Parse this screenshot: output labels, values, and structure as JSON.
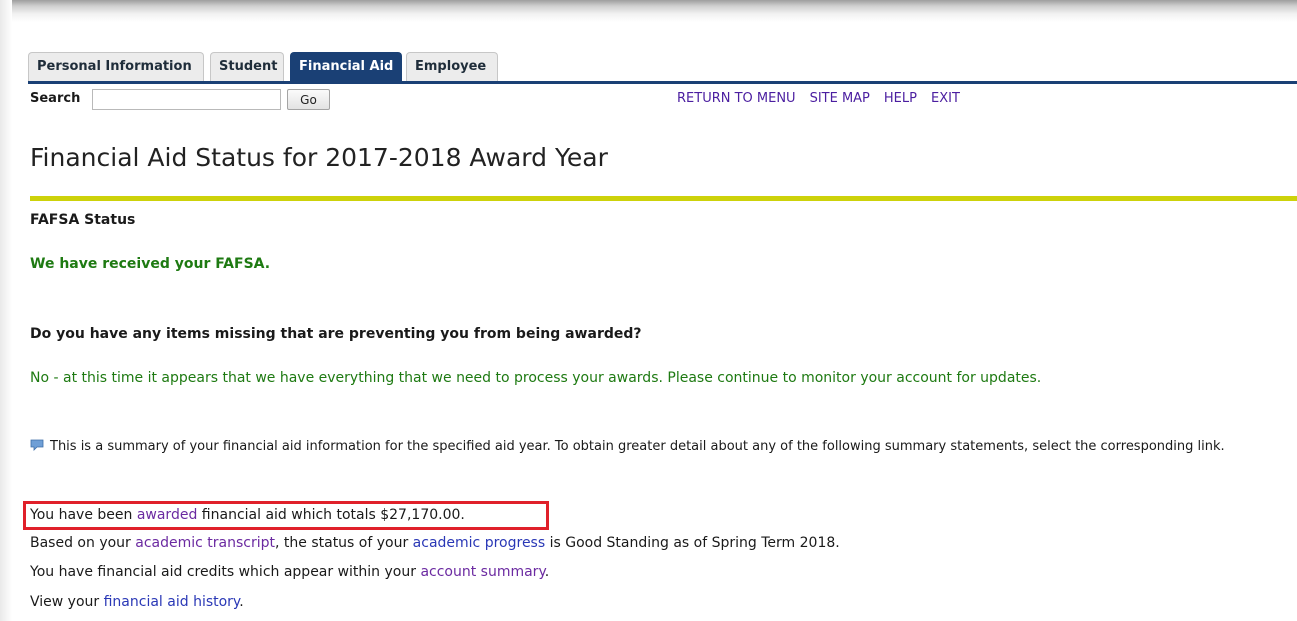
{
  "tabs": [
    {
      "label": "Personal Information",
      "active": false
    },
    {
      "label": "Student",
      "active": false
    },
    {
      "label": "Financial Aid",
      "active": true
    },
    {
      "label": "Employee",
      "active": false
    }
  ],
  "search": {
    "label": "Search",
    "value": "",
    "placeholder": "",
    "go_label": "Go"
  },
  "nav": {
    "return_to_menu": "RETURN TO MENU",
    "site_map": "SITE MAP",
    "help": "HELP",
    "exit": "EXIT"
  },
  "page_title": "Financial Aid Status for 2017-2018 Award Year",
  "fafsa": {
    "heading": "FAFSA Status",
    "status": "We have received your FAFSA."
  },
  "missing": {
    "question": "Do you have any items missing that are preventing you from being awarded?",
    "answer": "No - at this time it appears that we have everything that we need to process your awards.  Please continue to monitor your account for updates."
  },
  "info_note": "This is a summary of your financial aid information for the specified aid year. To obtain greater detail about any of the following summary statements, select the corresponding link.",
  "summary": {
    "awarded": {
      "prefix": "You have been ",
      "link": "awarded",
      "suffix": " financial aid which totals $27,170.00."
    },
    "academic": {
      "prefix": "Based on your ",
      "transcript_link": "academic transcript",
      "middle": ", the status of your ",
      "progress_link": "academic progress",
      "suffix": " is Good Standing as of Spring Term 2018."
    },
    "credits": {
      "prefix": "You have financial aid credits which appear within your ",
      "link": "account summary",
      "suffix": "."
    },
    "history": {
      "prefix": "View your ",
      "link": "financial aid history",
      "suffix": "."
    }
  },
  "colors": {
    "tab_active": "#1a4075",
    "accent_rule": "#cdd20a",
    "status_green": "#1e7a12",
    "highlight_box": "#e0202a",
    "link_visited": "#6b2aa1",
    "link": "#2a38b6"
  }
}
